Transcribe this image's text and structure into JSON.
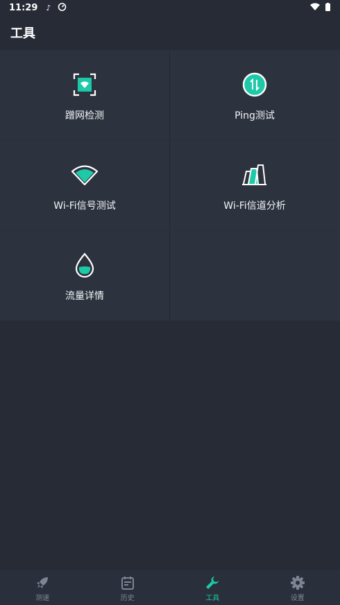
{
  "status_bar": {
    "time": "11:29"
  },
  "app_bar": {
    "title": "工具"
  },
  "tools": [
    {
      "label": "蹭网检测",
      "icon": "wifi-scan-icon"
    },
    {
      "label": "Ping测试",
      "icon": "ping-icon"
    },
    {
      "label": "Wi-Fi信号测试",
      "icon": "wifi-signal-icon"
    },
    {
      "label": "Wi-Fi信道分析",
      "icon": "channel-analysis-icon"
    },
    {
      "label": "流量详情",
      "icon": "traffic-drop-icon"
    }
  ],
  "tab_bar": {
    "items": [
      {
        "label": "测速",
        "icon": "rocket-icon",
        "active": false
      },
      {
        "label": "历史",
        "icon": "calendar-icon",
        "active": false
      },
      {
        "label": "工具",
        "icon": "wrench-icon",
        "active": true
      },
      {
        "label": "设置",
        "icon": "gear-icon",
        "active": false
      }
    ]
  },
  "colors": {
    "accent": "#1ec9a8",
    "background": "#262b35",
    "panel": "#2d333e",
    "inactive": "#7d8594"
  }
}
